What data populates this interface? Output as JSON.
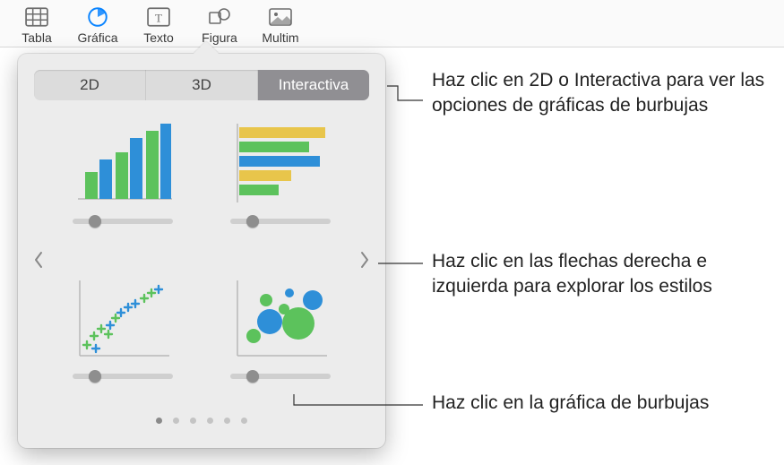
{
  "toolbar": {
    "items": [
      {
        "label": "Tabla"
      },
      {
        "label": "Gráfica"
      },
      {
        "label": "Texto"
      },
      {
        "label": "Figura"
      },
      {
        "label": "Multim"
      }
    ]
  },
  "segmented": {
    "tab_2d": "2D",
    "tab_3d": "3D",
    "tab_interactive": "Interactiva"
  },
  "callouts": {
    "top": "Haz clic en 2D o Interactiva para ver las opciones de gráficas de burbujas",
    "middle": "Haz clic en las flechas derecha e izquierda para explorar los estilos",
    "bottom": "Haz clic en la gráfica de burbujas"
  },
  "icons": {
    "tabla": "table-icon",
    "grafica": "piechart-icon",
    "texto": "textbox-icon",
    "figura": "shapes-icon",
    "multim": "media-icon"
  },
  "colors": {
    "accent_blue": "#0a84ff",
    "chart_green": "#5cc25c",
    "chart_blue": "#2e8fd8",
    "chart_yellow": "#e8c54b"
  },
  "page_dots": 6
}
